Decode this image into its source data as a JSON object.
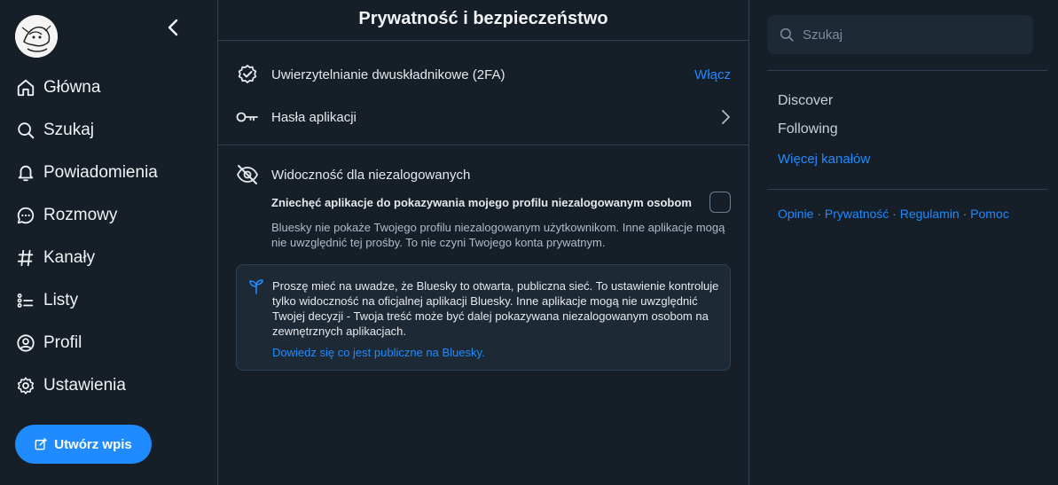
{
  "nav": {
    "items": [
      {
        "label": "Główna",
        "icon": "home-icon"
      },
      {
        "label": "Szukaj",
        "icon": "search-icon"
      },
      {
        "label": "Powiadomienia",
        "icon": "bell-icon"
      },
      {
        "label": "Rozmowy",
        "icon": "chat-icon"
      },
      {
        "label": "Kanały",
        "icon": "hash-icon"
      },
      {
        "label": "Listy",
        "icon": "list-icon"
      },
      {
        "label": "Profil",
        "icon": "user-icon"
      },
      {
        "label": "Ustawienia",
        "icon": "gear-icon"
      }
    ],
    "compose_label": "Utwórz wpis"
  },
  "page": {
    "title": "Prywatność i bezpieczeństwo",
    "twofa": {
      "label": "Uwierzytelnianie dwuskładnikowe (2FA)",
      "action": "Włącz"
    },
    "app_passwords": {
      "label": "Hasła aplikacji"
    },
    "visibility": {
      "title": "Widoczność dla niezalogowanych",
      "toggle_label": "Zniechęć aplikacje do pokazywania mojego profilu niezalogowanym osobom",
      "description": "Bluesky nie pokaże Twojego profilu niezalogowanym użytkownikom. Inne aplikacje mogą nie uwzględnić tej prośby. To nie czyni Twojego konta prywatnym.",
      "checked": false
    },
    "notice": {
      "text": "Proszę mieć na uwadze, że Bluesky to otwarta, publiczna sieć. To ustawienie kontroluje tylko widoczność na oficjalnej aplikacji Bluesky. Inne aplikacje mogą nie uwzględnić Twojej decyzji - Twoja treść może być dalej pokazywana niezalogowanym osobom na zewnętrznych aplikacjach.",
      "link": "Dowiedz się co jest publiczne na Bluesky."
    }
  },
  "right": {
    "search_placeholder": "Szukaj",
    "feeds": [
      "Discover",
      "Following"
    ],
    "more_feeds": "Więcej kanałów",
    "footer": [
      "Opinie",
      "Prywatność",
      "Regulamin",
      "Pomoc"
    ],
    "footer_sep": "·"
  },
  "colors": {
    "accent": "#208bfe",
    "background": "#161e27",
    "border": "#2e4052"
  }
}
